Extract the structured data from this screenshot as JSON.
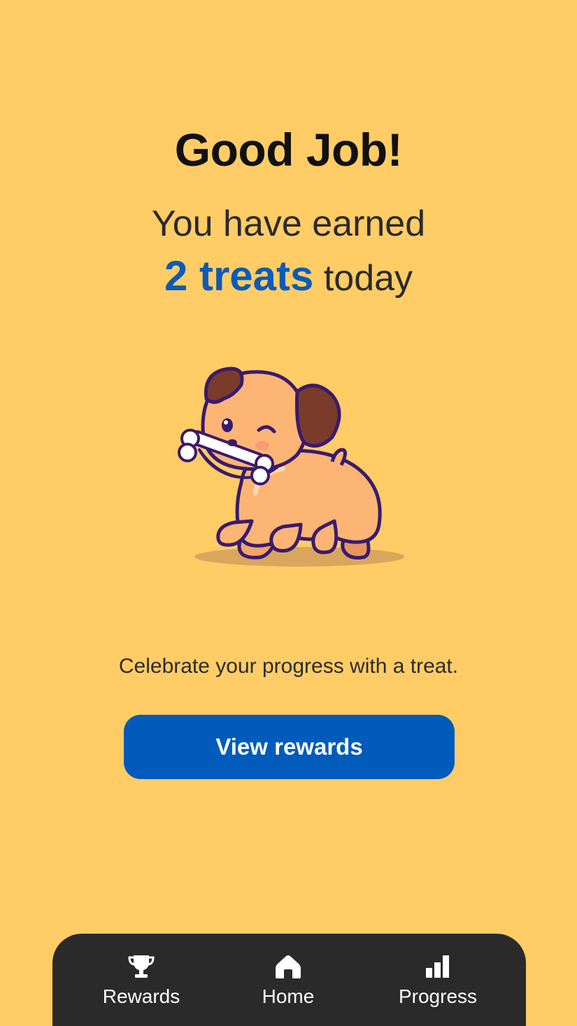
{
  "header": {
    "title": "Good Job!",
    "earned_text": "You have earned",
    "treats_count": "2 treats",
    "treats_suffix": " today"
  },
  "main": {
    "illustration": "puppy-with-bone-illustration",
    "message": "Celebrate your progress with a treat.",
    "cta_label": "View rewards"
  },
  "tabbar": {
    "tabs": [
      {
        "label": "Rewards",
        "icon": "trophy-icon"
      },
      {
        "label": "Home",
        "icon": "home-icon"
      },
      {
        "label": "Progress",
        "icon": "bar-chart-icon"
      }
    ]
  },
  "colors": {
    "background": "#FFCC66",
    "accent": "#005BBB",
    "tabbar": "#2A2A2A"
  }
}
